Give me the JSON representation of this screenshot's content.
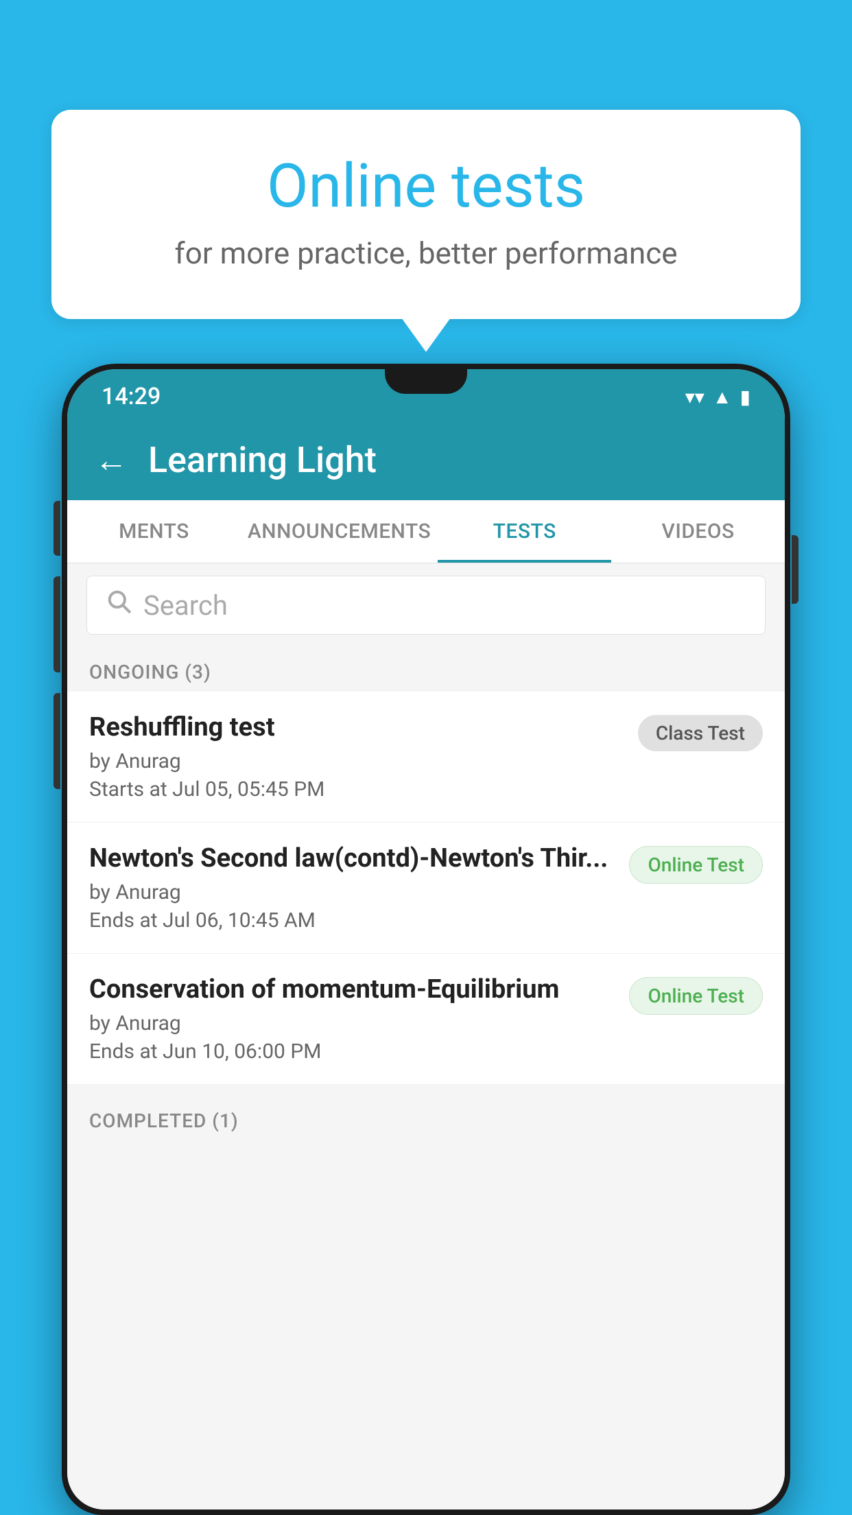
{
  "background_color": "#29b6e8",
  "speech_bubble": {
    "title": "Online tests",
    "subtitle": "for more practice, better performance"
  },
  "status_bar": {
    "time": "14:29",
    "icons": [
      "wifi",
      "signal",
      "battery"
    ]
  },
  "app_bar": {
    "title": "Learning Light",
    "back_label": "←"
  },
  "tabs": [
    {
      "label": "MENTS",
      "active": false
    },
    {
      "label": "ANNOUNCEMENTS",
      "active": false
    },
    {
      "label": "TESTS",
      "active": true
    },
    {
      "label": "VIDEOS",
      "active": false
    }
  ],
  "search": {
    "placeholder": "Search"
  },
  "ongoing_section": {
    "header": "ONGOING (3)",
    "items": [
      {
        "name": "Reshuffling test",
        "by": "by Anurag",
        "date": "Starts at  Jul 05, 05:45 PM",
        "badge": "Class Test",
        "badge_type": "grey"
      },
      {
        "name": "Newton's Second law(contd)-Newton's Thir...",
        "by": "by Anurag",
        "date": "Ends at  Jul 06, 10:45 AM",
        "badge": "Online Test",
        "badge_type": "green"
      },
      {
        "name": "Conservation of momentum-Equilibrium",
        "by": "by Anurag",
        "date": "Ends at  Jun 10, 06:00 PM",
        "badge": "Online Test",
        "badge_type": "green"
      }
    ]
  },
  "completed_section": {
    "header": "COMPLETED (1)"
  }
}
